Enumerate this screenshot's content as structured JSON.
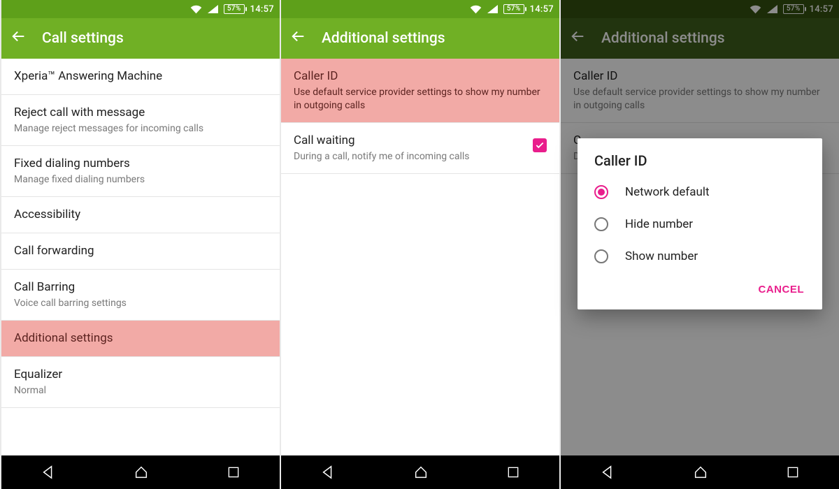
{
  "status": {
    "battery": "57%",
    "clock": "14:57"
  },
  "screen1": {
    "title": "Call settings",
    "items": [
      {
        "title": "Xperia™ Answering Machine"
      },
      {
        "title": "Reject call with message",
        "sub": "Manage reject messages for incoming calls"
      },
      {
        "title": "Fixed dialing numbers",
        "sub": "Manage fixed dialing numbers"
      },
      {
        "title": "Accessibility"
      },
      {
        "title": "Call forwarding"
      },
      {
        "title": "Call Barring",
        "sub": "Voice call barring settings"
      },
      {
        "title": "Additional settings",
        "highlight": true
      },
      {
        "title": "Equalizer",
        "sub": "Normal"
      }
    ]
  },
  "screen2": {
    "title": "Additional settings",
    "items": [
      {
        "title": "Caller ID",
        "sub": "Use default service provider settings to show my number in outgoing calls",
        "highlight": true
      },
      {
        "title": "Call waiting",
        "sub": "During a call, notify me of incoming calls",
        "checked": true
      }
    ]
  },
  "screen3": {
    "title": "Additional settings",
    "underItems": [
      {
        "title": "Caller ID",
        "sub": "Use default service provider settings to show my number in outgoing calls"
      },
      {
        "title": "C",
        "sub": "D"
      }
    ],
    "dialog": {
      "title": "Caller ID",
      "options": [
        {
          "label": "Network default",
          "selected": true
        },
        {
          "label": "Hide number",
          "selected": false
        },
        {
          "label": "Show number",
          "selected": false
        }
      ],
      "cancel": "CANCEL"
    }
  }
}
